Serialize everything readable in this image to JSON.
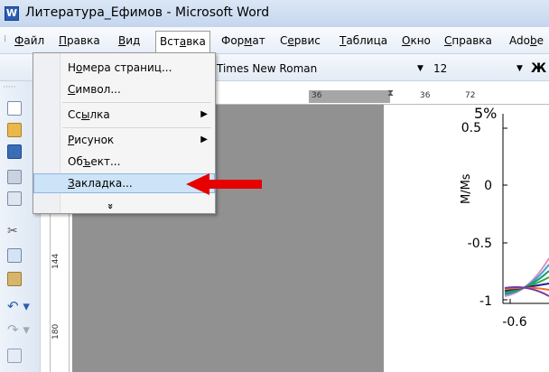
{
  "window": {
    "title": "Литература_Ефимов - Microsoft Word",
    "icon": "word-doc-icon"
  },
  "menubar": {
    "items": [
      {
        "label": "Файл",
        "u": "Ф",
        "rest": "айл"
      },
      {
        "label": "Правка",
        "u": "П",
        "rest": "равка"
      },
      {
        "label": "Вид",
        "u": "В",
        "rest": "ид"
      },
      {
        "label": "Вставка",
        "pre": "Вст",
        "u": "а",
        "rest": "вка"
      },
      {
        "label": "Формат",
        "pre": "Фор",
        "u": "м",
        "rest": "ат"
      },
      {
        "label": "Сервис",
        "pre": "С",
        "u": "е",
        "rest": "рвис"
      },
      {
        "label": "Таблица",
        "u": "Т",
        "rest": "аблица"
      },
      {
        "label": "Окно",
        "u": "О",
        "rest": "кно"
      },
      {
        "label": "Справка",
        "u": "С",
        "rest": "правка"
      },
      {
        "label": "Adobe",
        "pre": "Ado",
        "u": "b",
        "rest": "e"
      }
    ]
  },
  "format_toolbar": {
    "font_name": "Times New Roman",
    "font_size": "12",
    "bold_label": "Ж"
  },
  "insert_menu": {
    "items": [
      {
        "pre": "Н",
        "u": "о",
        "rest": "мера страниц..."
      },
      {
        "pre": "",
        "u": "С",
        "rest": "имвол..."
      },
      {
        "pre": "Сс",
        "u": "ы",
        "rest": "лка"
      },
      {
        "pre": "",
        "u": "Р",
        "rest": "исунок"
      },
      {
        "pre": "Об",
        "u": "ъ",
        "rest": "ект..."
      },
      {
        "pre": "",
        "u": "З",
        "rest": "акладка..."
      }
    ],
    "expand_label": "»"
  },
  "rulers": {
    "horizontal": [
      "36",
      "36",
      "72"
    ],
    "vertical": [
      "144",
      "180"
    ]
  },
  "chart_data": {
    "type": "line",
    "ylabel": "M/Ms",
    "yticks": [
      "0.5",
      "0",
      "-0.5",
      "-1"
    ],
    "xticks": [
      "-0.6"
    ],
    "title_fragment": "5%",
    "series_colors": [
      "#e88fb8",
      "#3aa0e0",
      "#1a9a6a",
      "#2ea84a",
      "#1b1b9e",
      "#f07020",
      "#7a3aa0"
    ]
  },
  "colors": {
    "accent": "#e60000",
    "highlight": "#cde3f8"
  }
}
